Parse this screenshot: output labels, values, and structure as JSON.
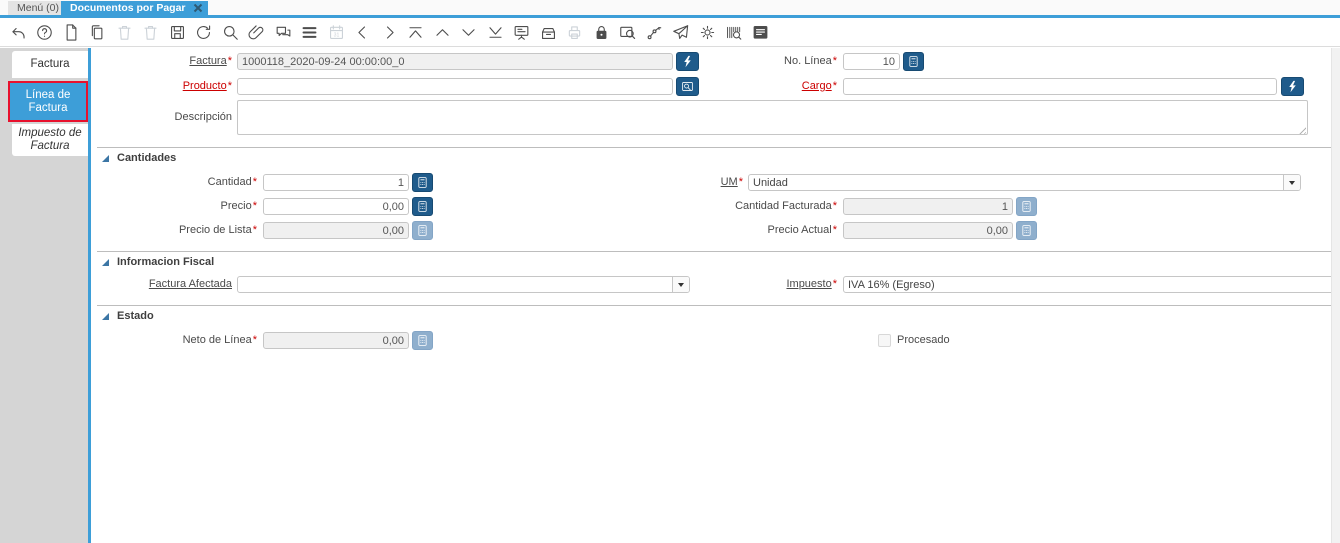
{
  "ui": {
    "required_marker": "*"
  },
  "tabbar": {
    "tabs": [
      {
        "label": "Menú (0)"
      },
      {
        "label": "Documentos por Pagar",
        "active": true
      }
    ]
  },
  "toolbar": {
    "icons": [
      {
        "name": "undo",
        "disabled": false
      },
      {
        "name": "help",
        "disabled": false
      },
      {
        "name": "new-record",
        "disabled": false
      },
      {
        "name": "copy-record",
        "disabled": false
      },
      {
        "name": "delete-record",
        "disabled": true
      },
      {
        "name": "delete-selection",
        "disabled": true
      },
      {
        "name": "save",
        "disabled": false
      },
      {
        "name": "refresh",
        "disabled": false
      },
      {
        "name": "find",
        "disabled": false
      },
      {
        "name": "attachment",
        "disabled": false
      },
      {
        "name": "chat",
        "disabled": false
      },
      {
        "name": "grid-toggle",
        "disabled": false
      },
      {
        "name": "calendar",
        "disabled": true
      },
      {
        "name": "parent-record",
        "disabled": false
      },
      {
        "name": "detail-record",
        "disabled": false
      },
      {
        "name": "first-record",
        "disabled": false
      },
      {
        "name": "previous-record",
        "disabled": false
      },
      {
        "name": "next-record",
        "disabled": false
      },
      {
        "name": "last-record",
        "disabled": false
      },
      {
        "name": "report",
        "disabled": false
      },
      {
        "name": "archive",
        "disabled": false
      },
      {
        "name": "print",
        "disabled": true
      },
      {
        "name": "lock",
        "disabled": false
      },
      {
        "name": "zoom-across",
        "disabled": false
      },
      {
        "name": "workflow",
        "disabled": false
      },
      {
        "name": "send",
        "disabled": false
      },
      {
        "name": "preferences",
        "disabled": false
      },
      {
        "name": "product-info",
        "disabled": false
      },
      {
        "name": "quick-form",
        "disabled": false
      }
    ]
  },
  "sidebar": {
    "tabs": [
      {
        "label": "Factura"
      },
      {
        "label": "Línea de Factura",
        "selected": true,
        "highlighted": true
      },
      {
        "label": "Impuesto de Factura",
        "italic": true
      }
    ]
  },
  "form": {
    "factura": {
      "label": "Factura",
      "value": "1000118_2020-09-24 00:00:00_0"
    },
    "no_linea": {
      "label": "No. Línea",
      "value": "10"
    },
    "producto": {
      "label": "Producto",
      "value": ""
    },
    "cargo": {
      "label": "Cargo",
      "value": ""
    },
    "descripcion": {
      "label": "Descripción",
      "value": ""
    },
    "sections": {
      "cantidades": "Cantidades",
      "informacion_fiscal": "Informacion Fiscal",
      "estado": "Estado"
    },
    "cantidad": {
      "label": "Cantidad",
      "value": "1"
    },
    "um": {
      "label": "UM",
      "value": "Unidad"
    },
    "precio": {
      "label": "Precio",
      "value": "0,00"
    },
    "cantidad_facturada": {
      "label": "Cantidad Facturada",
      "value": "1"
    },
    "precio_de_lista": {
      "label": "Precio de Lista",
      "value": "0,00"
    },
    "precio_actual": {
      "label": "Precio Actual",
      "value": "0,00"
    },
    "factura_afectada": {
      "label": "Factura Afectada",
      "value": ""
    },
    "impuesto": {
      "label": "Impuesto",
      "value": "IVA 16% (Egreso)"
    },
    "neto_de_linea": {
      "label": "Neto de Línea",
      "value": "0,00"
    },
    "procesado": {
      "label": "Procesado",
      "checked": false
    }
  },
  "colors": {
    "accent": "#3d9ed8",
    "button": "#1f5b8b",
    "button_disabled": "#8fafcd",
    "mandatory_red": "#cc0000",
    "annotation_red": "#e8112d"
  }
}
